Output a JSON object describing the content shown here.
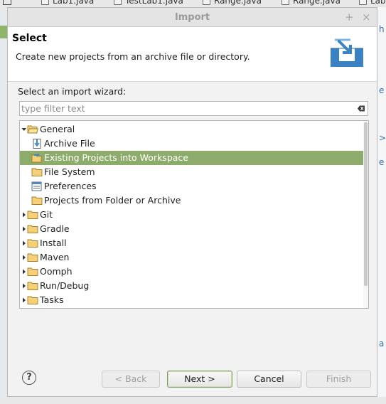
{
  "background": {
    "editor_tabs": [
      "Lab1.java",
      "TestLab1.java",
      "Range.java",
      "Range.java",
      "Lab"
    ],
    "right_glyphs": [
      "h",
      "e",
      ">",
      "e",
      "a"
    ]
  },
  "dialog": {
    "title": "Import",
    "title_buttons": [
      "+",
      "×"
    ],
    "header": {
      "title": "Select",
      "description": "Create new projects from an archive file or directory."
    },
    "wizard_label": "Select an import wizard:",
    "filter": {
      "placeholder": "type filter text",
      "value": ""
    },
    "tree": [
      {
        "label": "General",
        "expanded": true,
        "level": 0,
        "icon": "folder-open-icon"
      },
      {
        "label": "Archive File",
        "level": 1,
        "icon": "archive-file-icon"
      },
      {
        "label": "Existing Projects into Workspace",
        "level": 1,
        "icon": "existing-projects-icon",
        "selected": true
      },
      {
        "label": "File System",
        "level": 1,
        "icon": "folder-icon"
      },
      {
        "label": "Preferences",
        "level": 1,
        "icon": "preferences-icon"
      },
      {
        "label": "Projects from Folder or Archive",
        "level": 1,
        "icon": "folder-icon"
      },
      {
        "label": "Git",
        "level": 0,
        "icon": "folder-icon"
      },
      {
        "label": "Gradle",
        "level": 0,
        "icon": "folder-icon"
      },
      {
        "label": "Install",
        "level": 0,
        "icon": "folder-icon"
      },
      {
        "label": "Maven",
        "level": 0,
        "icon": "folder-icon"
      },
      {
        "label": "Oomph",
        "level": 0,
        "icon": "folder-icon"
      },
      {
        "label": "Run/Debug",
        "level": 0,
        "icon": "folder-icon"
      },
      {
        "label": "Tasks",
        "level": 0,
        "icon": "folder-icon"
      }
    ],
    "buttons": {
      "help": "?",
      "back": "< Back",
      "next": "Next >",
      "cancel": "Cancel",
      "finish": "Finish"
    },
    "colors": {
      "selection": "#8dac6c",
      "accent": "#3a86c8"
    }
  }
}
